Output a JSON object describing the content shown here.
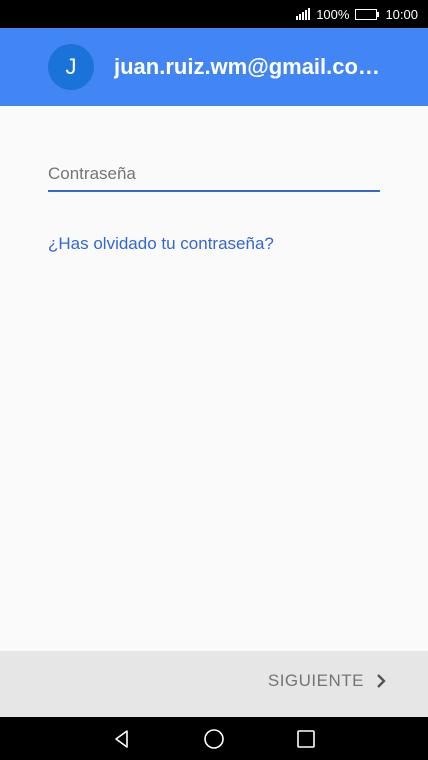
{
  "status_bar": {
    "battery_percent": "100%",
    "time": "10:00"
  },
  "header": {
    "avatar_letter": "J",
    "email": "juan.ruiz.wm@gmail.co…"
  },
  "form": {
    "password_placeholder": "Contraseña",
    "password_value": "",
    "forgot_link": "¿Has olvidado tu contraseña?"
  },
  "footer": {
    "next_label": "SIGUIENTE"
  },
  "colors": {
    "header_bg": "#4285f4",
    "avatar_bg": "#1a73d9",
    "accent": "#3367d6",
    "footer_bg": "#e6e6e6"
  },
  "icons": [
    "signal-icon",
    "battery-icon",
    "chevron-right-icon",
    "nav-back-icon",
    "nav-home-icon",
    "nav-recents-icon"
  ]
}
